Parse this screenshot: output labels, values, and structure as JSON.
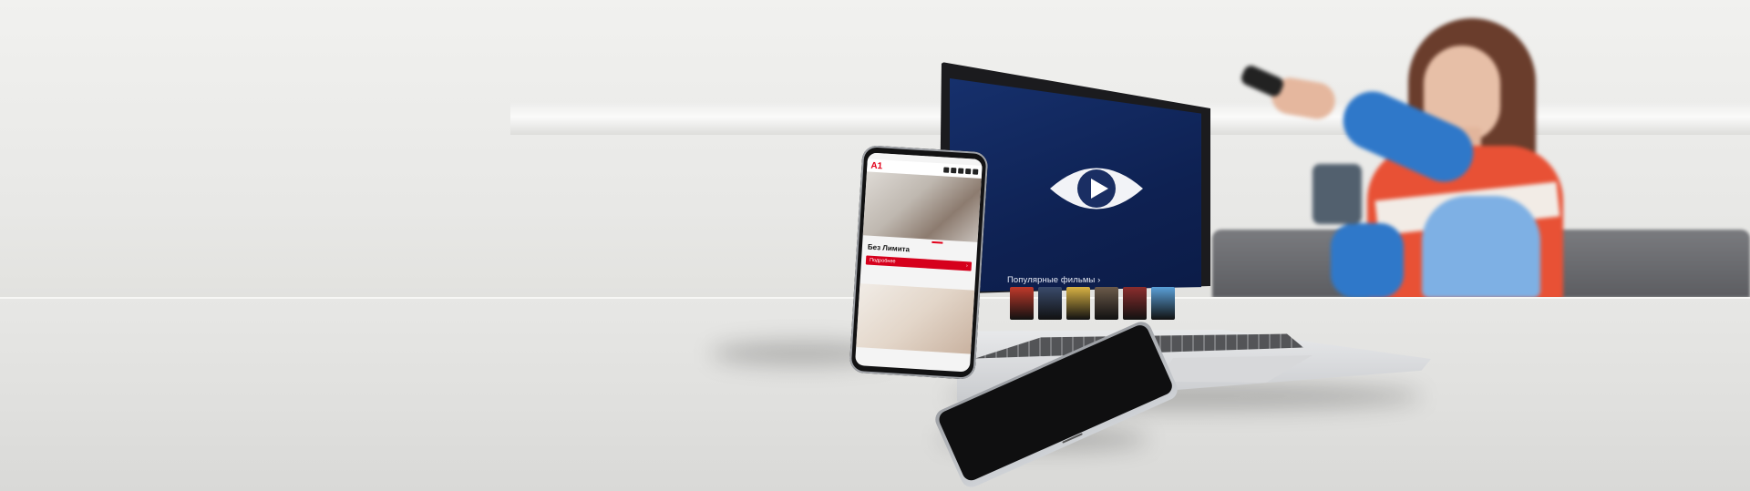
{
  "scene": {
    "description_label": "A1 multi-device streaming promo"
  },
  "laptop": {
    "popular_label": "Популярные фильмы ›",
    "thumb_colors": [
      "#c0392b",
      "#3a4b6b",
      "#d8b244",
      "#6b5a4a",
      "#8b2d2d",
      "#5aa0d8"
    ]
  },
  "phone": {
    "logo": "A1",
    "heading": "Без Лимита",
    "button_label": "Подробнее",
    "button_arrow": "›"
  },
  "colors": {
    "brand_red": "#e2001a",
    "screen_blue": "#0e2152"
  }
}
